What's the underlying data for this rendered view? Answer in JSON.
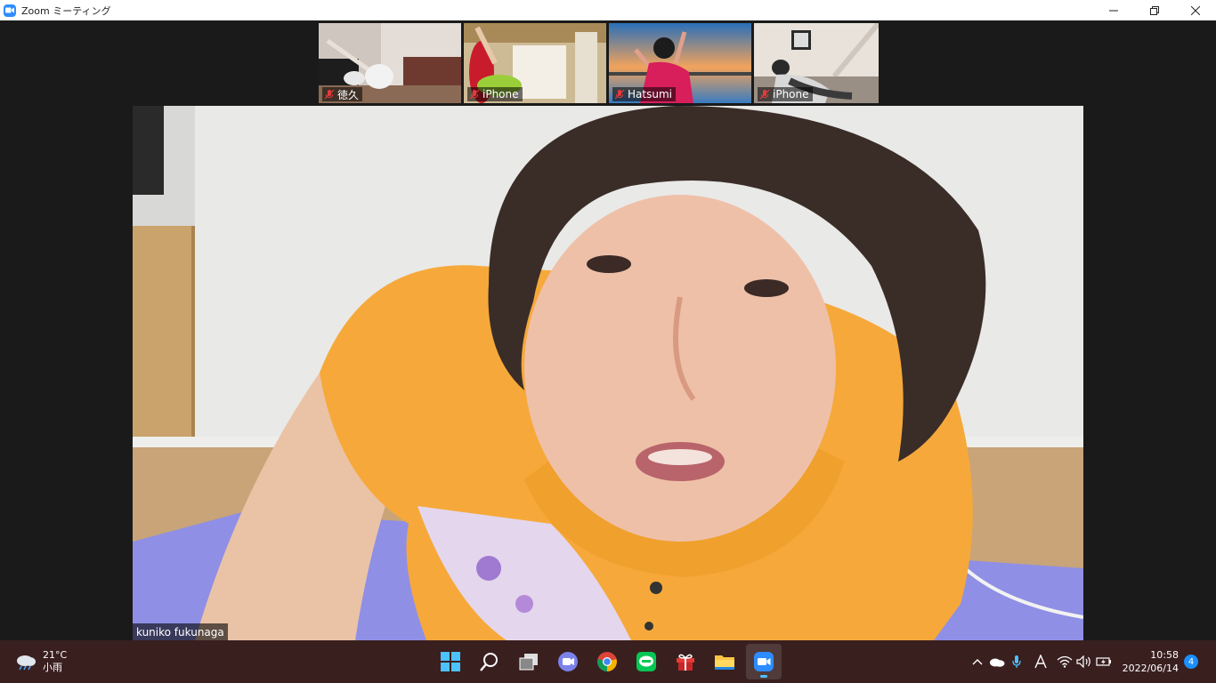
{
  "window": {
    "title": "Zoom ミーティング",
    "controls": [
      "minimize",
      "restore",
      "close"
    ]
  },
  "thumbnails": [
    {
      "name": "徳久",
      "muted": true
    },
    {
      "name": "iPhone",
      "muted": true
    },
    {
      "name": "Hatsumi",
      "muted": true
    },
    {
      "name": "iPhone",
      "muted": true
    }
  ],
  "main_video": {
    "name": "kuniko fukunaga"
  },
  "taskbar": {
    "weather": {
      "temp": "21°C",
      "condition": "小雨"
    },
    "apps": [
      "start-icon",
      "search-icon",
      "task-view-icon",
      "teams-chat-icon",
      "chrome-icon",
      "line-icon",
      "gift-icon",
      "file-explorer-icon",
      "zoom-icon"
    ],
    "clock": {
      "time": "10:58",
      "date": "2022/06/14"
    },
    "notification_count": "4"
  },
  "colors": {
    "zoom_blue": "#2d8cff",
    "taskbar_bg": "#3a1f1f",
    "meeting_bg": "#1a1a1a"
  }
}
